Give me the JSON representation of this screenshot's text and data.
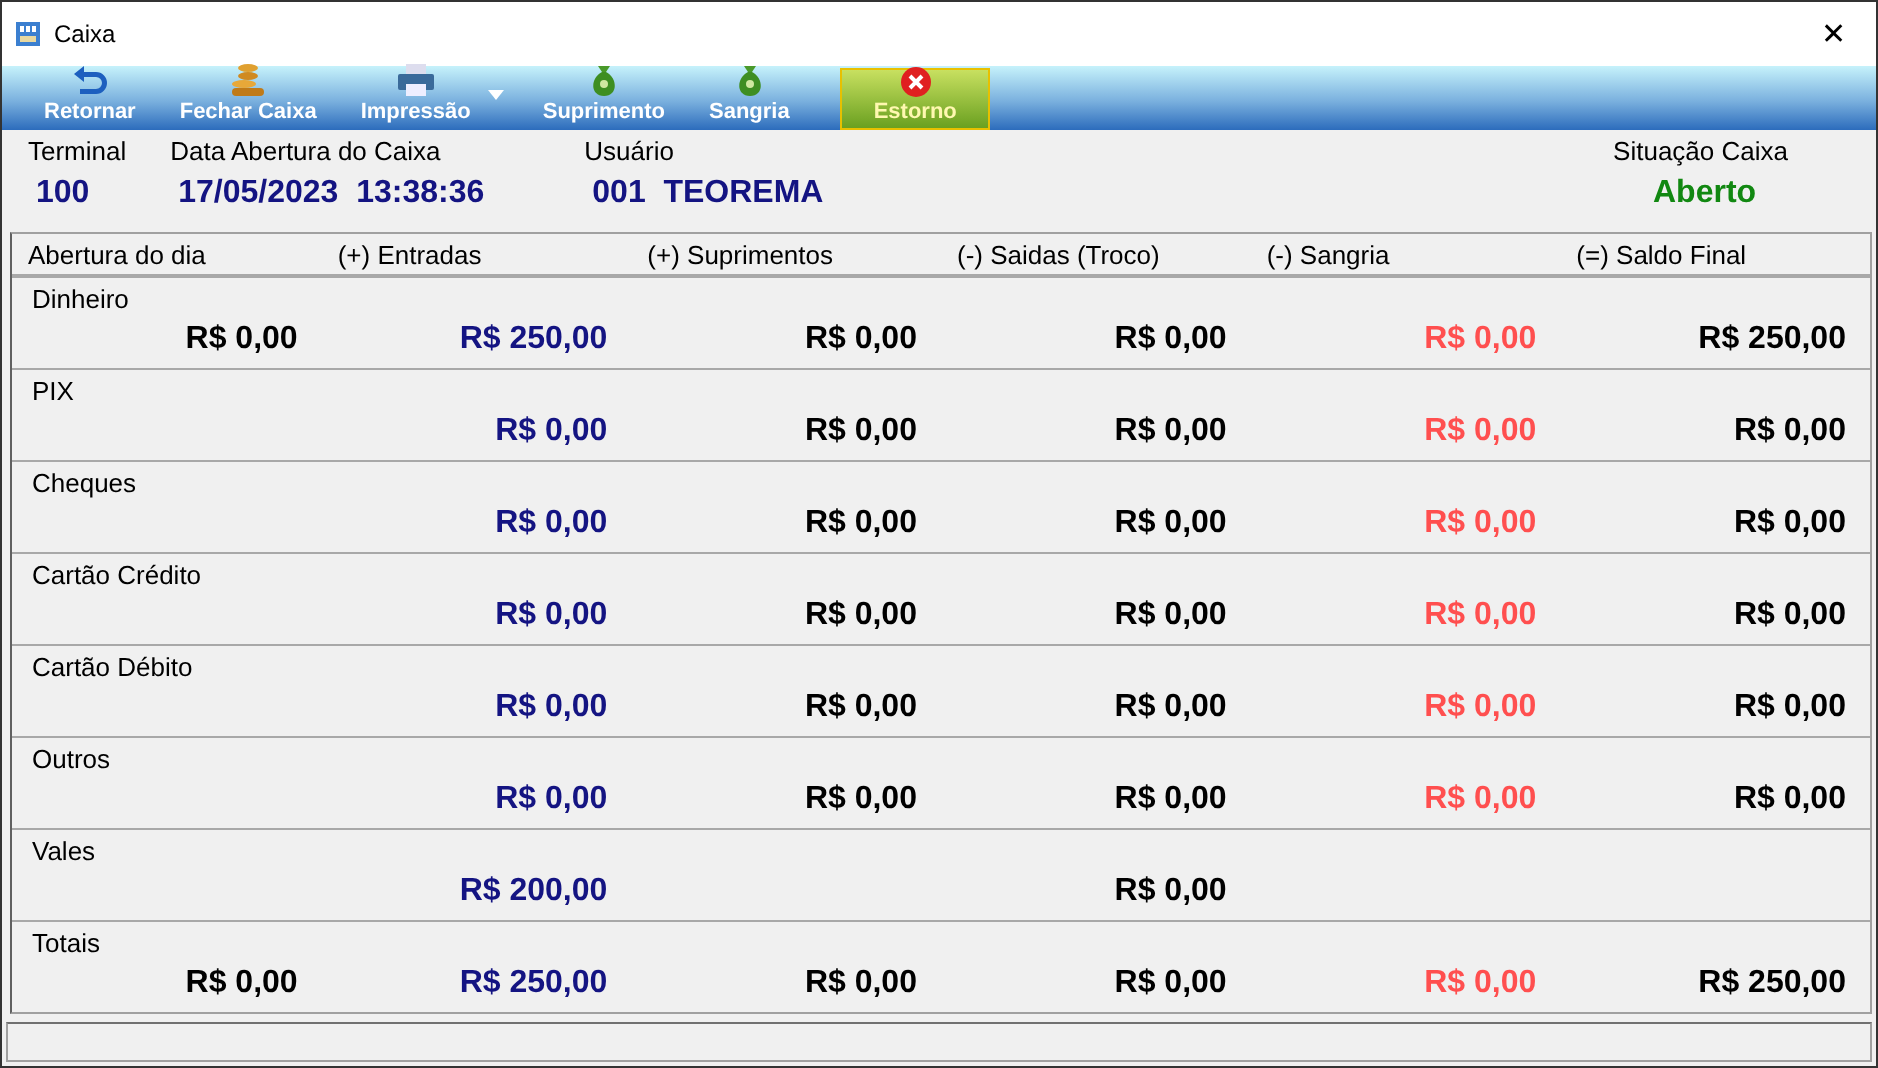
{
  "window": {
    "title": "Caixa",
    "close": "✕"
  },
  "toolbar": [
    {
      "label": "Retornar",
      "kind": "return",
      "selected": false,
      "dropdown": false
    },
    {
      "label": "Fechar Caixa",
      "kind": "coins",
      "selected": false,
      "dropdown": false
    },
    {
      "label": "Impressão",
      "kind": "printer",
      "selected": false,
      "dropdown": true
    },
    {
      "label": "Suprimento",
      "kind": "moneybag",
      "selected": false,
      "dropdown": false
    },
    {
      "label": "Sangria",
      "kind": "moneybag",
      "selected": false,
      "dropdown": false
    },
    {
      "label": "Estorno",
      "kind": "cancel",
      "selected": true,
      "dropdown": false
    }
  ],
  "info": [
    {
      "label": "Terminal",
      "value": "100"
    },
    {
      "label": "Data Abertura do Caixa",
      "value": "17/05/2023  13:38:36"
    },
    {
      "label": "Usuário",
      "value": "001  TEOREMA"
    },
    {
      "label": "Situação Caixa",
      "value": "Aberto",
      "color": "#118811"
    }
  ],
  "table": {
    "columns": [
      {
        "label": "Abertura do dia",
        "color": "#000000"
      },
      {
        "label": "(+) Entradas",
        "color": "#141482"
      },
      {
        "label": "(+) Suprimentos",
        "color": "#000000"
      },
      {
        "label": "(-) Saidas (Troco)",
        "color": "#000000"
      },
      {
        "label": "(-) Sangria",
        "color": "#ff4f4f"
      },
      {
        "label": "(=) Saldo Final",
        "color": "#000000"
      }
    ],
    "rows": [
      {
        "label": "Dinheiro",
        "opening": "R$ 0,00",
        "entries": "R$ 250,00",
        "supplies": "R$ 0,00",
        "withdrawals": "R$ 0,00",
        "sangria": "R$ 0,00",
        "balance": "R$ 250,00"
      },
      {
        "label": "PIX",
        "entries": "R$ 0,00",
        "supplies": "R$ 0,00",
        "withdrawals": "R$ 0,00",
        "sangria": "R$ 0,00",
        "balance": "R$ 0,00"
      },
      {
        "label": "Cheques",
        "entries": "R$ 0,00",
        "supplies": "R$ 0,00",
        "withdrawals": "R$ 0,00",
        "sangria": "R$ 0,00",
        "balance": "R$ 0,00"
      },
      {
        "label": "Cartão Crédito",
        "entries": "R$ 0,00",
        "supplies": "R$ 0,00",
        "withdrawals": "R$ 0,00",
        "sangria": "R$ 0,00",
        "balance": "R$ 0,00"
      },
      {
        "label": "Cartão Débito",
        "entries": "R$ 0,00",
        "supplies": "R$ 0,00",
        "withdrawals": "R$ 0,00",
        "sangria": "R$ 0,00",
        "balance": "R$ 0,00"
      },
      {
        "label": "Outros",
        "entries": "R$ 0,00",
        "supplies": "R$ 0,00",
        "withdrawals": "R$ 0,00",
        "sangria": "R$ 0,00",
        "balance": "R$ 0,00"
      },
      {
        "label": "Vales",
        "entries": "R$ 200,00",
        "withdrawals": "R$ 0,00"
      },
      {
        "label": "Totais",
        "opening": "R$ 0,00",
        "entries": "R$ 250,00",
        "supplies": "R$ 0,00",
        "withdrawals": "R$ 0,00",
        "sangria": "R$ 0,00",
        "balance": "R$ 250,00"
      }
    ]
  }
}
